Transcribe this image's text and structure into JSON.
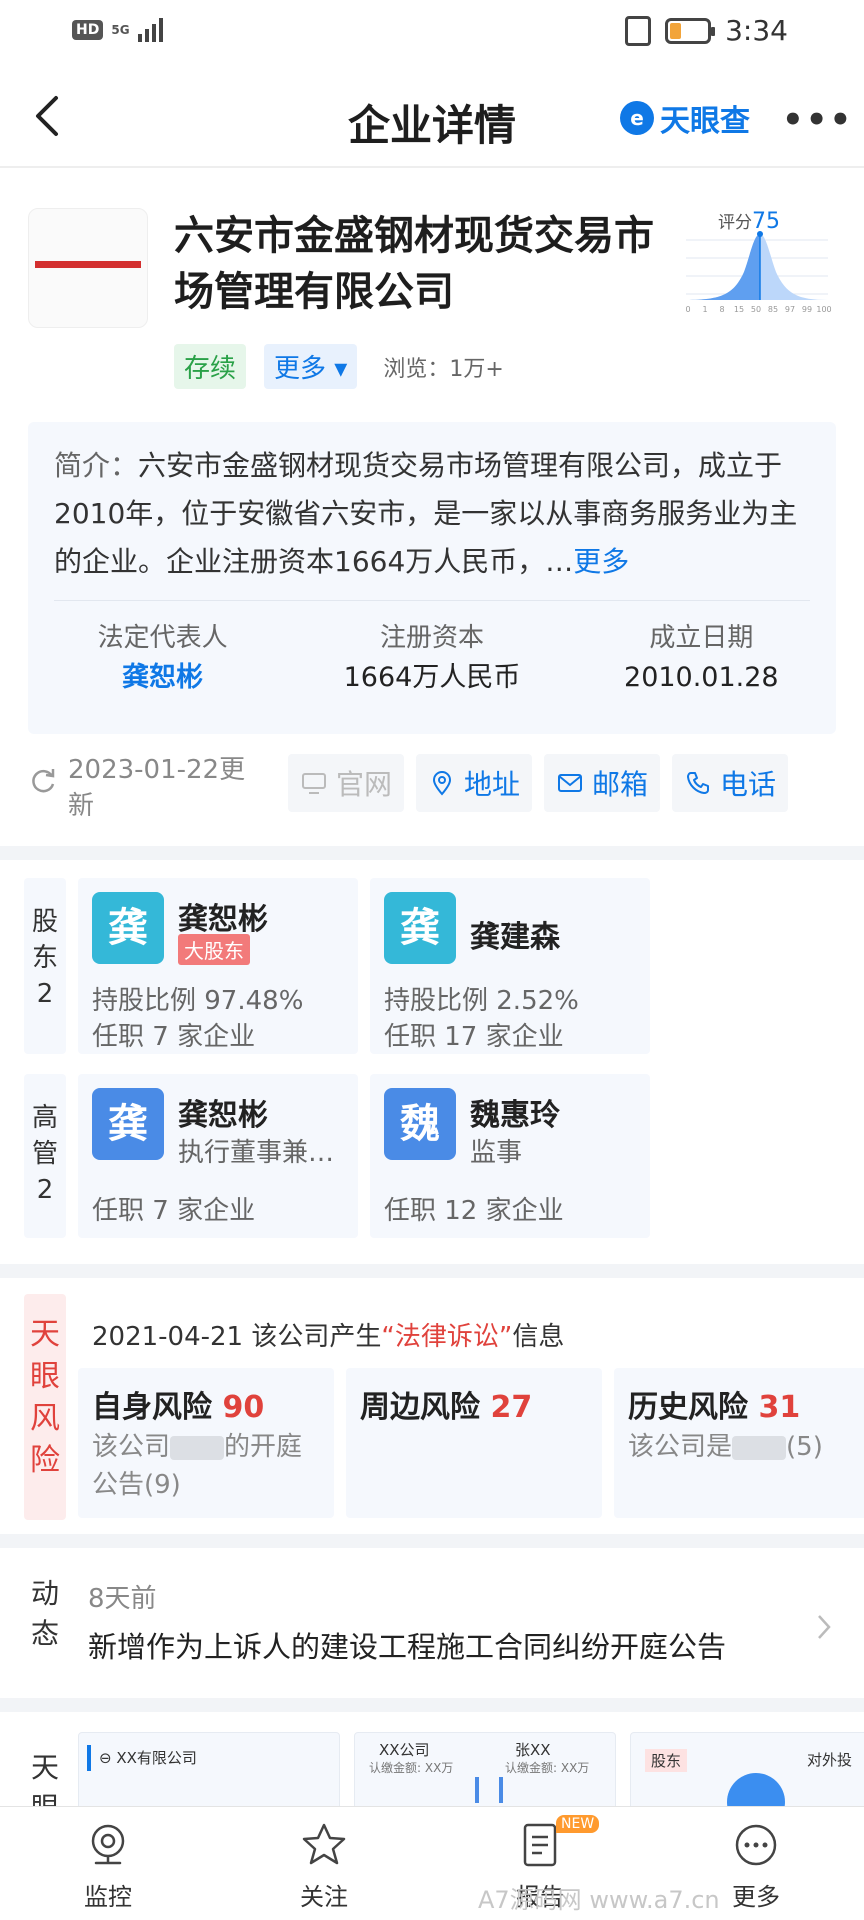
{
  "status_bar": {
    "network": "HD",
    "signal": "5G",
    "time": "3:34"
  },
  "header": {
    "title": "企业详情",
    "brand": "天眼查"
  },
  "company": {
    "name": "六安市金盛钢材现货交易市场管理有限公司",
    "score_label": "评分",
    "score": "75",
    "score_axis": [
      "0",
      "1",
      "8",
      "15",
      "50",
      "85",
      "97",
      "99",
      "100"
    ],
    "status": "存续",
    "more_label": "更多",
    "views": "浏览：1万+",
    "intro_key": "简介：",
    "intro": "六安市金盛钢材现货交易市场管理有限公司，成立于2010年，位于安徽省六安市，是一家以从事商务服务业为主的企业。企业注册资本1664万人民币，…",
    "intro_more": "更多",
    "facts": [
      {
        "label": "法定代表人",
        "value": "龚恕彬"
      },
      {
        "label": "注册资本",
        "value": "1664万人民币"
      },
      {
        "label": "成立日期",
        "value": "2010.01.28"
      }
    ],
    "updated": "2023-01-22更新",
    "contacts": [
      "官网",
      "地址",
      "邮箱",
      "电话"
    ]
  },
  "shareholders": {
    "label": "股东2",
    "items": [
      {
        "avatar": "龚",
        "name": "龚恕彬",
        "badge": "大股东",
        "ratio": "持股比例 97.48%",
        "jobs": "任职 7 家企业"
      },
      {
        "avatar": "龚",
        "name": "龚建森",
        "ratio": "持股比例 2.52%",
        "jobs": "任职 17 家企业"
      }
    ]
  },
  "executives": {
    "label": "高管2",
    "items": [
      {
        "avatar": "龚",
        "name": "龚恕彬",
        "role": "执行董事兼…",
        "jobs": "任职 7 家企业"
      },
      {
        "avatar": "魏",
        "name": "魏惠玲",
        "role": "监事",
        "jobs": "任职 12 家企业"
      }
    ]
  },
  "risk": {
    "label": "天眼风险",
    "date": "2021-04-21 该公司产生",
    "highlight": "“法律诉讼”",
    "suffix": "信息",
    "cards": [
      {
        "title": "自身风险",
        "count": "90",
        "desc_a": "该公司",
        "desc_b": "的开庭公告(9)"
      },
      {
        "title": "周边风险",
        "count": "27"
      },
      {
        "title": "历史风险",
        "count": "31",
        "desc_a": "该公司是",
        "desc_b": "(5)"
      }
    ]
  },
  "dynamics": {
    "label": "动态",
    "time": "8天前",
    "text": "新增作为上诉人的建设工程施工合同纠纷开庭公告"
  },
  "graph": {
    "label": "天眼",
    "card1": "XX有限公司",
    "card2_a": "XX公司",
    "card2_a_sub": "认缴金额: XX万",
    "card2_b": "张XX",
    "card2_b_sub": "认缴金额: XX万",
    "card3_a": "股东",
    "card3_b": "对外投"
  },
  "tabs": [
    {
      "label": "监控"
    },
    {
      "label": "关注"
    },
    {
      "label": "报告",
      "badge": "NEW"
    },
    {
      "label": "更多"
    }
  ],
  "watermark": "A7源码网 www.a7.cn",
  "colors": {
    "accent": "#0f78e6",
    "risk_red": "#e0423c",
    "status_green": "#2aa148"
  }
}
